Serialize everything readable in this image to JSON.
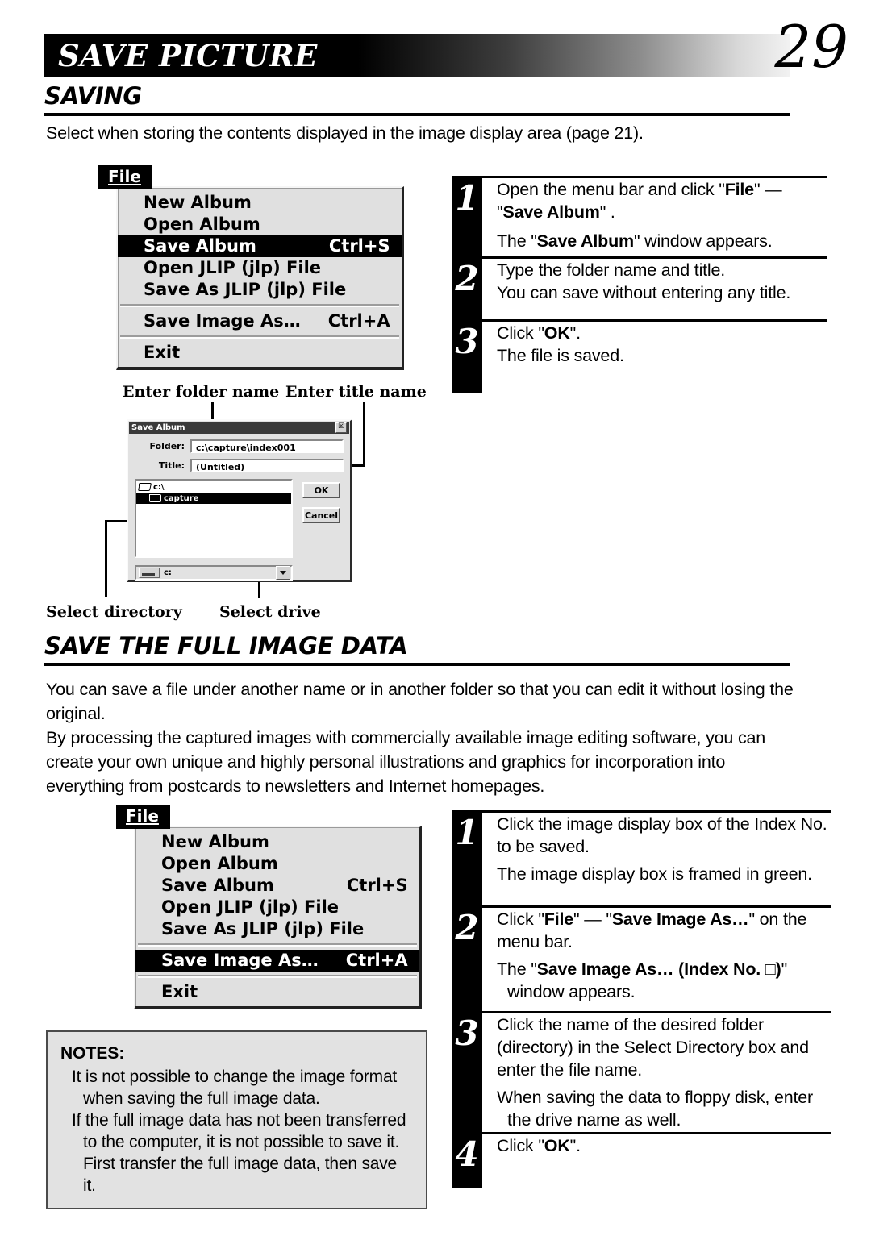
{
  "header": {
    "title": "SAVE PICTURE",
    "page_number": "29"
  },
  "sections": [
    {
      "heading": "SAVING",
      "intro": "Select when storing the contents displayed in the image display area (page 21)."
    },
    {
      "heading": "SAVE THE FULL IMAGE DATA",
      "paragraphs": [
        "You can save a file under another name or in another folder so that you can edit it without losing the original.",
        "By processing the captured images with commercially available image editing software, you can create your own unique and highly personal illustrations and graphics for incorporation into everything from postcards to newsletters and Internet homepages."
      ]
    }
  ],
  "menu_one": {
    "tab_label_pre": "F",
    "tab_label_accel": "i",
    "tab_label_post": "le",
    "tab_label": "File",
    "items": [
      {
        "label": "New Album",
        "accel": "",
        "highlighted": false
      },
      {
        "label": "Open Album",
        "accel": "",
        "highlighted": false
      },
      {
        "label": "Save Album",
        "accel": "Ctrl+S",
        "highlighted": true
      },
      {
        "label": "Open JLIP (jlp) File",
        "accel": "",
        "highlighted": false
      },
      {
        "label": "Save As JLIP (jlp) File",
        "accel": "",
        "highlighted": false
      },
      {
        "label": "Save Image As…",
        "accel": "Ctrl+A",
        "highlighted": false
      },
      {
        "label": "Exit",
        "accel": "",
        "highlighted": false
      }
    ]
  },
  "menu_two": {
    "tab_label": "File",
    "items": [
      {
        "label": "New Album",
        "accel": "",
        "highlighted": false
      },
      {
        "label": "Open Album",
        "accel": "",
        "highlighted": false
      },
      {
        "label": "Save Album",
        "accel": "Ctrl+S",
        "highlighted": false
      },
      {
        "label": "Open JLIP (jlp) File",
        "accel": "",
        "highlighted": false
      },
      {
        "label": "Save As JLIP (jlp) File",
        "accel": "",
        "highlighted": false
      },
      {
        "label": "Save Image As…",
        "accel": "Ctrl+A",
        "highlighted": true
      },
      {
        "label": "Exit",
        "accel": "",
        "highlighted": false
      }
    ]
  },
  "dialog": {
    "title": "Save Album",
    "close_glyph": "☒",
    "folder_label": "Folder:",
    "folder_value": "c:\\capture\\index001",
    "title_label": "Title:",
    "title_value": "(Untitled)",
    "directories": [
      {
        "name": "c:\\",
        "selected": false,
        "indent": false
      },
      {
        "name": "capture",
        "selected": true,
        "indent": true
      }
    ],
    "ok_label": "OK",
    "cancel_label": "Cancel",
    "drive_value": "c:"
  },
  "callouts": {
    "enter_folder_name": "Enter folder name",
    "enter_title_name": "Enter title name",
    "select_directory": "Select directory",
    "select_drive": "Select drive"
  },
  "steps_one": [
    {
      "number": "1",
      "lines": [
        {
          "type": "text",
          "html": "Open the menu bar and click \"<b>File</b>\" — \"<b>Save Album</b>\" ."
        },
        {
          "type": "bullet",
          "html": "The \"<b>Save Album</b>\" window appears."
        }
      ]
    },
    {
      "number": "2",
      "lines": [
        {
          "type": "text",
          "html": "Type the folder name and title."
        },
        {
          "type": "bullet",
          "html": "You can save without entering any title."
        }
      ]
    },
    {
      "number": "3",
      "lines": [
        {
          "type": "text",
          "html": "Click \"<b>OK</b>\"."
        },
        {
          "type": "bullet",
          "html": "The file is saved."
        }
      ]
    }
  ],
  "steps_two": [
    {
      "number": "1",
      "lines": [
        {
          "type": "text",
          "html": "Click the image display box of the Index No. to be saved."
        },
        {
          "type": "bullet",
          "html": "The image display box is framed in green."
        }
      ]
    },
    {
      "number": "2",
      "lines": [
        {
          "type": "text",
          "html": "Click \"<b>File</b>\" — \"<b>Save Image As…</b>\" on the menu bar."
        },
        {
          "type": "bullet",
          "html": "The \"<b>Save Image As… (Index No. □)</b>\" window appears."
        }
      ]
    },
    {
      "number": "3",
      "lines": [
        {
          "type": "text",
          "html": "Click the name of the desired folder (directory) in the Select Directory box and enter the file name."
        },
        {
          "type": "bullet",
          "html": "When saving the data to floppy disk, enter the drive name as well."
        }
      ]
    },
    {
      "number": "4",
      "lines": [
        {
          "type": "text",
          "html": "Click \"<b>OK</b>\"."
        }
      ]
    }
  ],
  "notes": {
    "heading": "NOTES:",
    "items": [
      "It is not possible to change the image format when saving the full image data.",
      "If the full image data has not been transferred to the computer, it is not possible to save it.  First transfer the full image data, then save it."
    ]
  }
}
